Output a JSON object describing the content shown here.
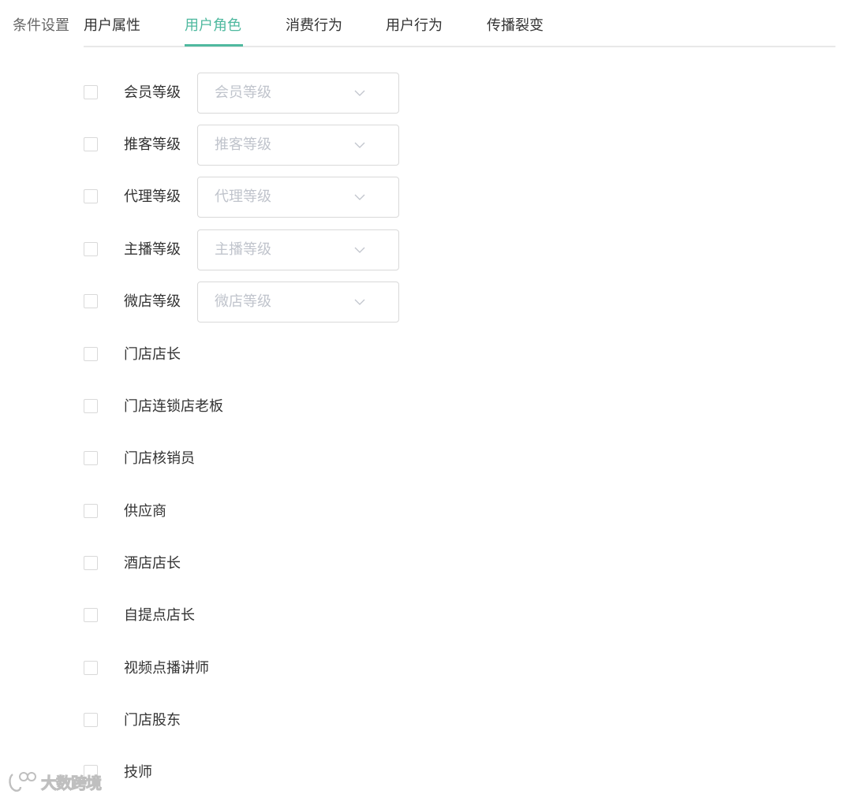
{
  "section_label": "条件设置",
  "tabs": [
    {
      "label": "用户属性",
      "active": false
    },
    {
      "label": "用户角色",
      "active": true
    },
    {
      "label": "消费行为",
      "active": false
    },
    {
      "label": "用户行为",
      "active": false
    },
    {
      "label": "传播裂变",
      "active": false
    }
  ],
  "accent_color": "#4fb99f",
  "rows": [
    {
      "label": "会员等级",
      "checked": false,
      "select_placeholder": "会员等级"
    },
    {
      "label": "推客等级",
      "checked": false,
      "select_placeholder": "推客等级"
    },
    {
      "label": "代理等级",
      "checked": false,
      "select_placeholder": "代理等级"
    },
    {
      "label": "主播等级",
      "checked": false,
      "select_placeholder": "主播等级"
    },
    {
      "label": "微店等级",
      "checked": false,
      "select_placeholder": "微店等级"
    },
    {
      "label": "门店店长",
      "checked": false
    },
    {
      "label": "门店连锁店老板",
      "checked": false
    },
    {
      "label": "门店核销员",
      "checked": false
    },
    {
      "label": "供应商",
      "checked": false
    },
    {
      "label": "酒店店长",
      "checked": false
    },
    {
      "label": "自提点店长",
      "checked": false
    },
    {
      "label": "视频点播讲师",
      "checked": false
    },
    {
      "label": "门店股东",
      "checked": false
    },
    {
      "label": "技师",
      "checked": false
    }
  ],
  "watermark": {
    "text": "大数跨境",
    "icon": "logo-icon"
  }
}
